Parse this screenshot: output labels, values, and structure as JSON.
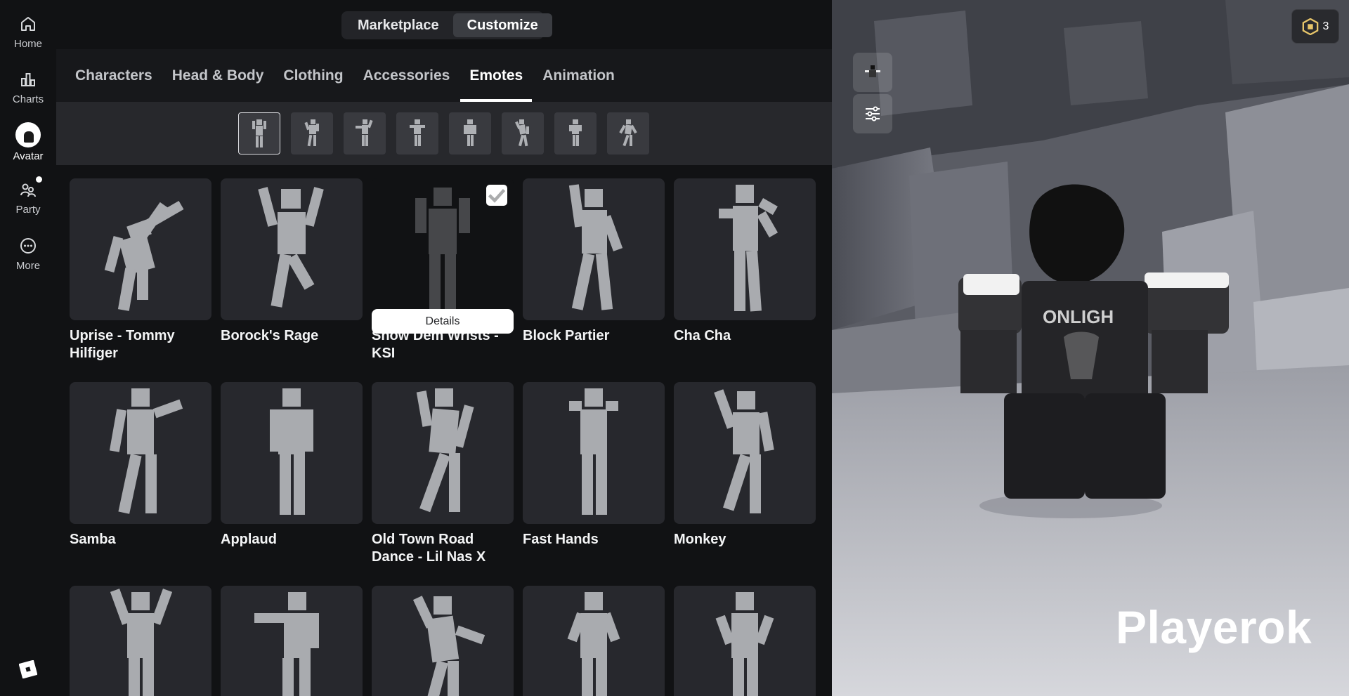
{
  "nav": {
    "items": [
      {
        "label": "Home",
        "icon": "home-icon"
      },
      {
        "label": "Charts",
        "icon": "charts-icon"
      },
      {
        "label": "Avatar",
        "icon": "avatar-icon"
      },
      {
        "label": "Party",
        "icon": "party-icon"
      },
      {
        "label": "More",
        "icon": "more-icon"
      }
    ],
    "active": "Avatar"
  },
  "top_tabs": {
    "marketplace": "Marketplace",
    "customize": "Customize",
    "active": "Customize"
  },
  "category_tabs": [
    {
      "label": "Characters"
    },
    {
      "label": "Head & Body"
    },
    {
      "label": "Clothing"
    },
    {
      "label": "Accessories"
    },
    {
      "label": "Emotes"
    },
    {
      "label": "Animation"
    }
  ],
  "active_category": "Emotes",
  "emotes": [
    {
      "name": "Uprise - Tommy Hilfiger"
    },
    {
      "name": "Borock's Rage"
    },
    {
      "name": "Show Dem Wrists - KSI",
      "equipped": true,
      "details_label": "Details"
    },
    {
      "name": "Block Partier"
    },
    {
      "name": "Cha Cha"
    },
    {
      "name": "Samba"
    },
    {
      "name": "Applaud"
    },
    {
      "name": "Old Town Road Dance - Lil Nas X"
    },
    {
      "name": "Fast Hands"
    },
    {
      "name": "Monkey"
    }
  ],
  "robux": {
    "count": "3"
  },
  "player": {
    "name": "Playerok"
  },
  "colors": {
    "accent": "#ffffff",
    "background": "#111214",
    "card": "#27282d"
  }
}
